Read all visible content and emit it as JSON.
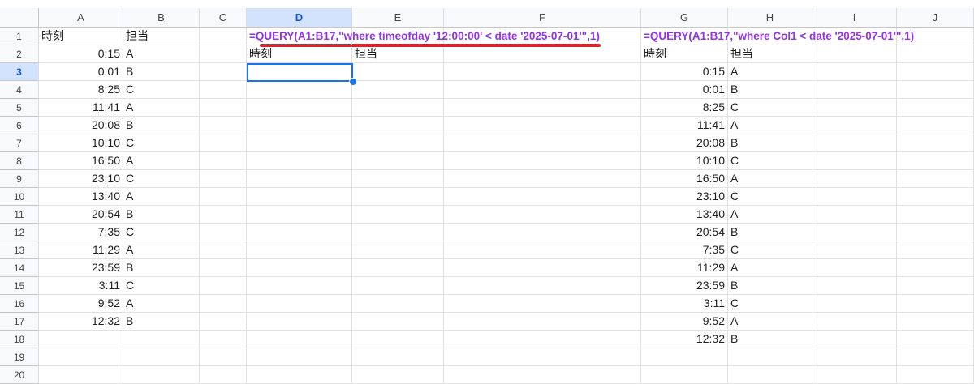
{
  "columns": [
    "A",
    "B",
    "C",
    "D",
    "E",
    "F",
    "G",
    "H",
    "I",
    "J"
  ],
  "selected_column": "D",
  "selected_row": 3,
  "row_count": 20,
  "accent_color": "#1a73e8",
  "formula_color": "#9334e6",
  "annotation_color": "#e0202a",
  "cells": {
    "A1": "時刻",
    "B1": "担当",
    "A2": "0:15",
    "B2": "A",
    "A3": "0:01",
    "B3": "B",
    "A4": "8:25",
    "B4": "C",
    "A5": "11:41",
    "B5": "A",
    "A6": "20:08",
    "B6": "B",
    "A7": "10:10",
    "B7": "C",
    "A8": "16:50",
    "B8": "A",
    "A9": "23:10",
    "B9": "C",
    "A10": "13:40",
    "B10": "A",
    "A11": "20:54",
    "B11": "B",
    "A12": "7:35",
    "B12": "C",
    "A13": "11:29",
    "B13": "A",
    "A14": "23:59",
    "B14": "B",
    "A15": "3:11",
    "B15": "C",
    "A16": "9:52",
    "B16": "A",
    "A17": "12:32",
    "B17": "B",
    "D1": "=QUERY(A1:B17,\"where timeofday '12:00:00' < date '2025-07-01'\",1)",
    "D2": "時刻",
    "E2": "担当",
    "G1": "=QUERY(A1:B17,\"where Col1 < date '2025-07-01'\",1)",
    "G2": "時刻",
    "H2": "担当",
    "G3": "0:15",
    "H3": "A",
    "G4": "0:01",
    "H4": "B",
    "G5": "8:25",
    "H5": "C",
    "G6": "11:41",
    "H6": "A",
    "G7": "20:08",
    "H7": "B",
    "G8": "10:10",
    "H8": "C",
    "G9": "16:50",
    "H9": "A",
    "G10": "23:10",
    "H10": "C",
    "G11": "13:40",
    "H11": "A",
    "G12": "20:54",
    "H12": "B",
    "G13": "7:35",
    "H13": "C",
    "G14": "11:29",
    "H14": "A",
    "G15": "23:59",
    "H15": "B",
    "G16": "3:11",
    "H16": "C",
    "G17": "9:52",
    "H17": "A",
    "G18": "12:32",
    "H18": "B"
  }
}
